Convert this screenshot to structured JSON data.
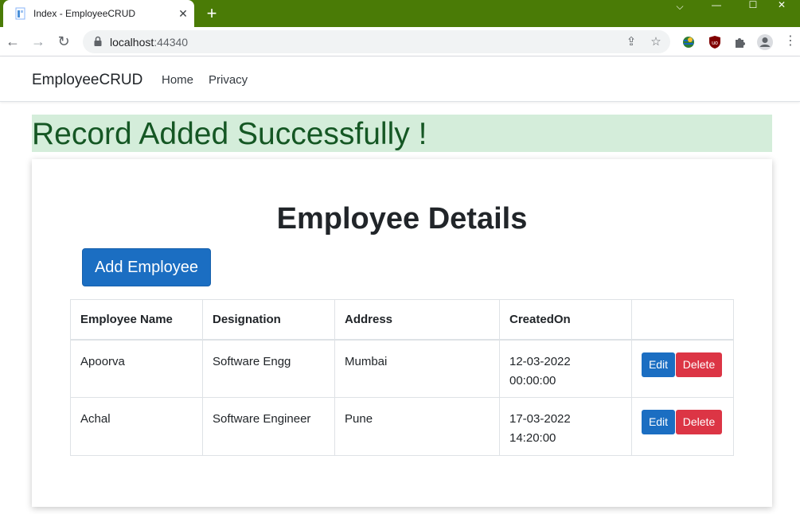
{
  "browser": {
    "tab_title": "Index - EmployeeCRUD",
    "url_host": "localhost",
    "url_port": ":44340"
  },
  "navbar": {
    "brand": "EmployeeCRUD",
    "links": [
      "Home",
      "Privacy"
    ]
  },
  "alert": {
    "message": "Record Added Successfully !",
    "bg_color": "#d4edda",
    "text_color": "#155724"
  },
  "main": {
    "title": "Employee Details",
    "add_button": "Add Employee",
    "table": {
      "headers": [
        "Employee Name",
        "Designation",
        "Address",
        "CreatedOn",
        ""
      ],
      "rows": [
        {
          "name": "Apoorva",
          "designation": "Software Engg",
          "address": "Mumbai",
          "created_date": "12-03-2022",
          "created_time": "00:00:00"
        },
        {
          "name": "Achal",
          "designation": "Software Engineer",
          "address": "Pune",
          "created_date": "17-03-2022",
          "created_time": "14:20:00"
        }
      ],
      "edit_label": "Edit",
      "delete_label": "Delete"
    }
  },
  "colors": {
    "primary": "#1b6ec2",
    "danger": "#dc3545",
    "titlebar": "#4a7b06"
  }
}
